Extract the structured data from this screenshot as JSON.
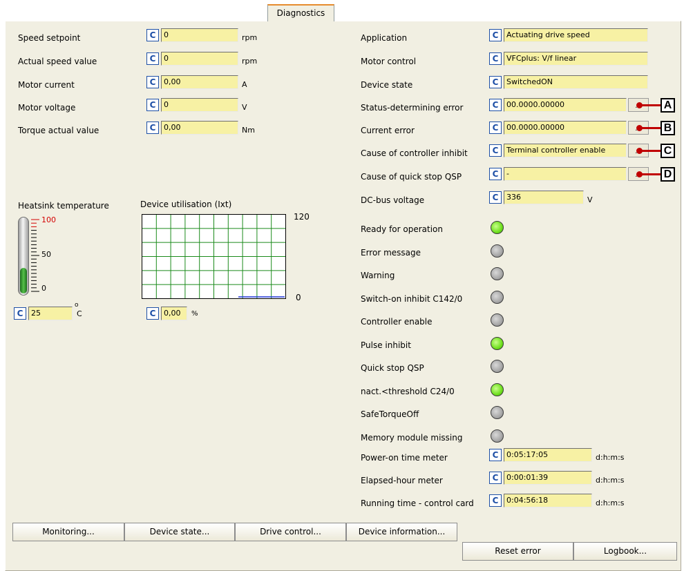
{
  "tab": {
    "label": "Diagnostics"
  },
  "c_label": "C",
  "left": {
    "rows": [
      {
        "label": "Speed setpoint",
        "value": "0",
        "unit": "rpm"
      },
      {
        "label": "Actual speed value",
        "value": "0",
        "unit": "rpm"
      },
      {
        "label": "Motor current",
        "value": "0,00",
        "unit": "A"
      },
      {
        "label": "Motor voltage",
        "value": "0",
        "unit": "V"
      },
      {
        "label": "Torque actual value",
        "value": "0,00",
        "unit": "Nm"
      }
    ],
    "heatsink": {
      "label": "Heatsink temperature",
      "value": "25",
      "unit_deg": "o",
      "unit": "C",
      "scale_top": "100",
      "scale_mid": "50",
      "scale_bot": "0",
      "level_percent": 25
    },
    "utilisation": {
      "label": "Device utilisation (Ixt)",
      "value": "0,00",
      "unit": "%",
      "axis_max": "120",
      "axis_min": "0"
    }
  },
  "right": {
    "text_rows": [
      {
        "label": "Application",
        "value": "Actuating drive speed"
      },
      {
        "label": "Motor control",
        "value": "VFCplus: V/f linear"
      },
      {
        "label": "Device state",
        "value": "SwitchedON"
      }
    ],
    "error_rows": [
      {
        "label": "Status-determining error",
        "value": "00.0000.00000",
        "dots": "...",
        "marker": "A"
      },
      {
        "label": "Current error",
        "value": "00.0000.00000",
        "dots": "...",
        "marker": "B"
      },
      {
        "label": "Cause of controller inhibit",
        "value": "Terminal controller enable",
        "dots": "...",
        "marker": "C"
      },
      {
        "label": "Cause of quick stop QSP",
        "value": "-",
        "dots": "...",
        "marker": "D"
      }
    ],
    "dc_bus": {
      "label": "DC-bus voltage",
      "value": "336",
      "unit": "V"
    },
    "status_leds": [
      {
        "label": "Ready for operation",
        "state": "on"
      },
      {
        "label": "Error message",
        "state": "off"
      },
      {
        "label": "Warning",
        "state": "off"
      },
      {
        "label": "Switch-on inhibit C142/0",
        "state": "off"
      },
      {
        "label": "Controller enable",
        "state": "off"
      },
      {
        "label": "Pulse inhibit",
        "state": "on"
      },
      {
        "label": "Quick stop QSP",
        "state": "off"
      },
      {
        "label": "nact.<threshold C24/0",
        "state": "on"
      },
      {
        "label": "SafeTorqueOff",
        "state": "off"
      },
      {
        "label": "Memory module missing",
        "state": "off"
      }
    ],
    "meters": [
      {
        "label": "Power-on time meter",
        "value": "0:05:17:05",
        "unit": "d:h:m:s"
      },
      {
        "label": "Elapsed-hour meter",
        "value": "0:00:01:39",
        "unit": "d:h:m:s"
      },
      {
        "label": "Running time - control card",
        "value": "0:04:56:18",
        "unit": "d:h:m:s"
      }
    ]
  },
  "bottom_buttons": [
    "Monitoring...",
    "Device state...",
    "Drive control...",
    "Device information..."
  ],
  "action_buttons": [
    "Reset error",
    "Logbook..."
  ],
  "colors": {
    "field_bg": "#f7f1a4",
    "c_blue": "#1d4fa6",
    "led_on": "#6fdf1e",
    "led_off": "#a7a7a7",
    "marker_red": "#c00000",
    "grid_green": "#1a8a1a"
  }
}
